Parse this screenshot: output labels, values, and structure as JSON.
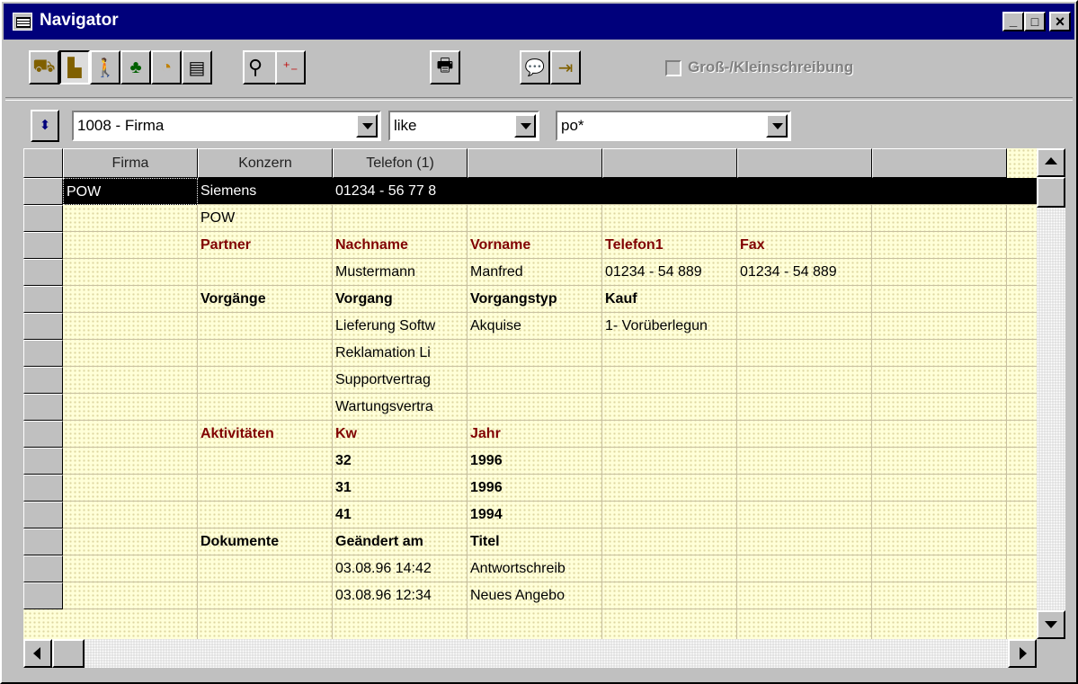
{
  "window": {
    "title": "Navigator",
    "controls": {
      "minimize": "_",
      "maximize": "□",
      "close": "×"
    }
  },
  "toolbar": {
    "buttons": [
      {
        "icon": "truck-icon"
      },
      {
        "icon": "building-icon",
        "pressed": true
      },
      {
        "icon": "person-icon"
      },
      {
        "icon": "hierarchy-icon"
      },
      {
        "icon": "clock-icon"
      },
      {
        "icon": "calculator-icon"
      },
      {
        "icon": "search-icon"
      },
      {
        "icon": "plus-minus-icon"
      },
      {
        "icon": "printer-icon"
      },
      {
        "icon": "help-icon"
      },
      {
        "icon": "exit-icon"
      }
    ],
    "case_sensitive_label": "Groß-/Kleinschreibung"
  },
  "filter": {
    "field": "1008 - Firma",
    "operator": "like",
    "value": "po*"
  },
  "grid": {
    "columns": [
      "Firma",
      "Konzern",
      "Telefon (1)",
      "",
      "",
      "",
      ""
    ],
    "rows": [
      [
        "POW",
        "Siemens",
        "01234 - 56 77 8",
        "",
        "",
        "",
        ""
      ],
      [
        "",
        "POW",
        "",
        "",
        "",
        "",
        ""
      ],
      [
        "",
        "Partner",
        "Nachname",
        "Vorname",
        "Telefon1",
        "Fax",
        ""
      ],
      [
        "",
        "",
        "Mustermann",
        "Manfred",
        "01234 - 54 889",
        "01234 - 54 889",
        ""
      ],
      [
        "",
        "Vorgänge",
        "Vorgang",
        "Vorgangstyp",
        "Kauf",
        "",
        ""
      ],
      [
        "",
        "",
        "Lieferung Softw",
        "Akquise",
        "1- Vorüberlegun",
        "",
        ""
      ],
      [
        "",
        "",
        "Reklamation Li",
        "",
        "",
        "",
        ""
      ],
      [
        "",
        "",
        "Supportvertrag",
        "",
        "",
        "",
        ""
      ],
      [
        "",
        "",
        "Wartungsvertra",
        "",
        "",
        "",
        ""
      ],
      [
        "",
        "Aktivitäten",
        "Kw",
        "Jahr",
        "",
        "",
        ""
      ],
      [
        "",
        "",
        "32",
        "1996",
        "",
        "",
        ""
      ],
      [
        "",
        "",
        "31",
        "1996",
        "",
        "",
        ""
      ],
      [
        "",
        "",
        "41",
        "1994",
        "",
        "",
        ""
      ],
      [
        "",
        "Dokumente",
        "Geändert am",
        "Titel",
        "",
        "",
        ""
      ],
      [
        "",
        "",
        "03.08.96 14:42",
        "Antwortschreib",
        "",
        "",
        ""
      ],
      [
        "",
        "",
        "03.08.96 12:34",
        "Neues Angebo",
        "",
        "",
        ""
      ]
    ],
    "row_styles": [
      "sel",
      "",
      "red",
      "",
      "bold",
      "",
      "",
      "",
      "",
      "red",
      "bold",
      "bold",
      "bold",
      "bold",
      "",
      ""
    ]
  }
}
